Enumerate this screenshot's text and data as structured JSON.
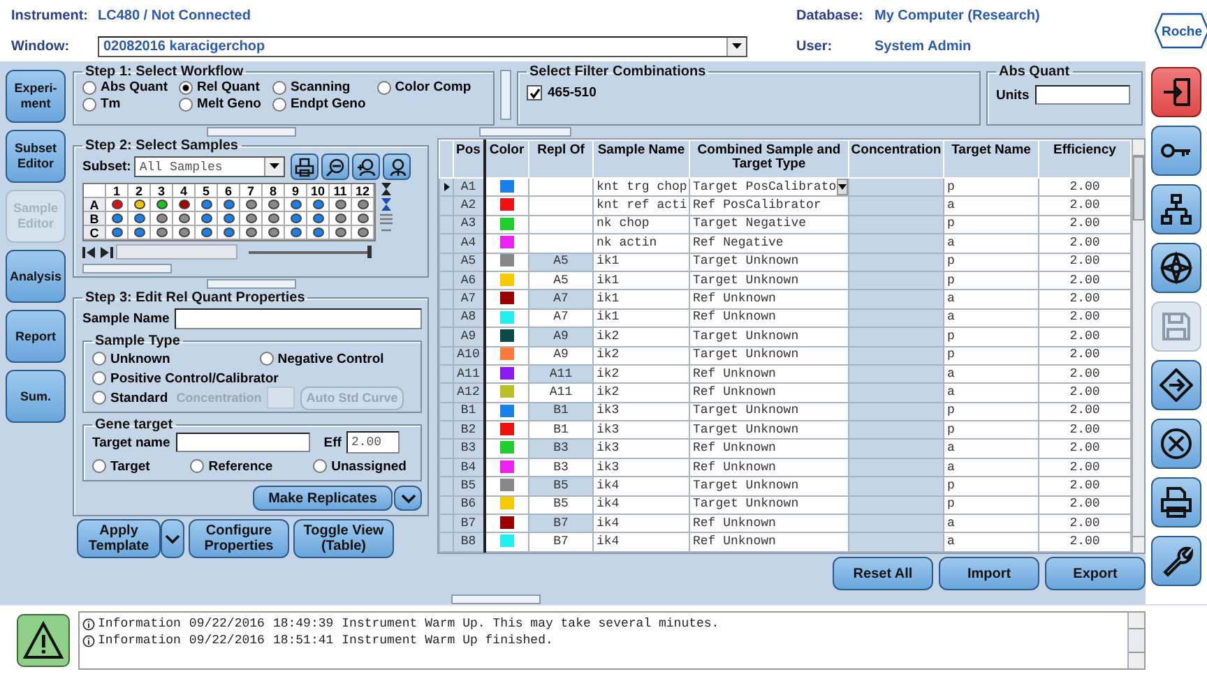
{
  "header": {
    "instrument_label": "Instrument:",
    "instrument": "LC480 / Not Connected",
    "window_label": "Window:",
    "window_value": "02082016 karacigerchop",
    "database_label": "Database:",
    "database": "My Computer (Research)",
    "user_label": "User:",
    "user": "System Admin",
    "logo": "Roche"
  },
  "nav": [
    {
      "label": "Experi-ment",
      "disabled": false
    },
    {
      "label": "Subset Editor",
      "disabled": false
    },
    {
      "label": "Sample Editor",
      "disabled": true
    },
    {
      "label": "Analysis",
      "disabled": false
    },
    {
      "label": "Report",
      "disabled": false
    },
    {
      "label": "Sum.",
      "disabled": false
    }
  ],
  "step1": {
    "title": "Step 1: Select Workflow",
    "options": [
      {
        "label": "Abs Quant",
        "selected": false
      },
      {
        "label": "Rel Quant",
        "selected": true
      },
      {
        "label": "Scanning",
        "selected": false
      },
      {
        "label": "Color Comp",
        "selected": false
      },
      {
        "label": "Tm",
        "selected": false
      },
      {
        "label": "Melt Geno",
        "selected": false
      },
      {
        "label": "Endpt Geno",
        "selected": false
      }
    ]
  },
  "filters": {
    "title": "Select Filter Combinations",
    "items": [
      {
        "label": "465-510",
        "checked": true
      }
    ]
  },
  "abs_quant": {
    "title": "Abs Quant",
    "units_label": "Units"
  },
  "step2": {
    "title": "Step 2: Select Samples",
    "subset_label": "Subset:",
    "subset_value": "All Samples",
    "zoom_slider": {
      "level": 1
    },
    "columns": [
      "1",
      "2",
      "3",
      "4",
      "5",
      "6",
      "7",
      "8",
      "9",
      "10",
      "11",
      "12"
    ],
    "rows": [
      {
        "label": "A",
        "wells": [
          {
            "color": "#e01010"
          },
          {
            "color": "#f0c800"
          },
          {
            "color": "#20c020"
          },
          {
            "color": "#a00000"
          },
          {
            "color": "#1a7fe8"
          },
          {
            "color": "#1a7fe8"
          },
          {
            "color": "#8a8a8a"
          },
          {
            "color": "#8a8a8a"
          },
          {
            "color": "#1a7fe8"
          },
          {
            "color": "#1a7fe8"
          },
          {
            "color": "#8a8a8a"
          },
          {
            "color": "#8a8a8a"
          }
        ]
      },
      {
        "label": "B",
        "wells": [
          {
            "color": "#1a7fe8"
          },
          {
            "color": "#1a7fe8"
          },
          {
            "color": "#8a8a8a"
          },
          {
            "color": "#8a8a8a"
          },
          {
            "color": "#1a7fe8"
          },
          {
            "color": "#1a7fe8"
          },
          {
            "color": "#8a8a8a"
          },
          {
            "color": "#8a8a8a"
          },
          {
            "color": "#1a7fe8"
          },
          {
            "color": "#1a7fe8"
          },
          {
            "color": "#8a8a8a"
          },
          {
            "color": "#8a8a8a"
          }
        ]
      },
      {
        "label": "C",
        "wells": [
          {
            "color": "#1a7fe8"
          },
          {
            "color": "#1a7fe8"
          },
          {
            "color": "#8a8a8a"
          },
          {
            "color": "#8a8a8a"
          },
          {
            "color": "#1a7fe8"
          },
          {
            "color": "#1a7fe8"
          },
          {
            "color": "#8a8a8a"
          },
          {
            "color": "#8a8a8a"
          },
          {
            "color": "#1a7fe8"
          },
          {
            "color": "#1a7fe8"
          },
          {
            "color": "#8a8a8a"
          },
          {
            "color": "#8a8a8a"
          }
        ]
      }
    ]
  },
  "step3": {
    "title": "Step 3: Edit Rel Quant Properties",
    "sample_name_label": "Sample Name",
    "sample_type": {
      "title": "Sample Type",
      "options": [
        {
          "label": "Unknown",
          "selected": false
        },
        {
          "label": "Negative Control",
          "selected": false
        },
        {
          "label": "Positive Control/Calibrator",
          "selected": false
        },
        {
          "label": "Standard",
          "selected": false
        }
      ],
      "concentration_label": "Concentration",
      "auto_button": "Auto Std Curve",
      "standard_disabled": true
    },
    "gene_target": {
      "title": "Gene target",
      "name_label": "Target name",
      "eff_label": "Eff",
      "eff_value": "2.00",
      "options": [
        {
          "label": "Target",
          "selected": false
        },
        {
          "label": "Reference",
          "selected": false
        },
        {
          "label": "Unassigned",
          "selected": false
        }
      ]
    },
    "make_replicates": "Make Replicates"
  },
  "bottom_buttons": [
    {
      "label": "Apply Template",
      "dropdown": true
    },
    {
      "label": "Configure Properties",
      "dropdown": false
    },
    {
      "label": "Toggle View (Table)",
      "dropdown": false
    }
  ],
  "table": {
    "columns": [
      "Pos",
      "Color",
      "Repl Of",
      "Sample Name",
      "Combined Sample and Target Type",
      "Concentration",
      "Target Name",
      "Efficiency"
    ],
    "rows": [
      {
        "pos": "A1",
        "color": "#1a7fe8",
        "sample_name": "knt trg chop",
        "type": "Target PosCalibrato",
        "target": "p",
        "efficiency": "2.00",
        "selected": true
      },
      {
        "pos": "A2",
        "color": "#ee1111",
        "sample_name": "knt ref acti",
        "type": "Ref PosCalibrator",
        "target": "a",
        "efficiency": "2.00",
        "selected": false
      },
      {
        "pos": "A3",
        "color": "#22cc33",
        "sample_name": "nk chop",
        "type": "Target Negative",
        "target": "p",
        "efficiency": "2.00",
        "selected": false
      },
      {
        "pos": "A4",
        "color": "#ee22ee",
        "sample_name": "nk actin",
        "type": "Ref Negative",
        "target": "a",
        "efficiency": "2.00",
        "selected": false
      },
      {
        "pos": "A5",
        "color": "#888888",
        "repl_of": "A5",
        "repl_shaded": true,
        "sample_name": "ik1",
        "type": "Target Unknown",
        "target": "p",
        "efficiency": "2.00",
        "selected": false
      },
      {
        "pos": "A6",
        "color": "#f5c800",
        "repl_of": "A5",
        "repl_shaded": false,
        "sample_name": "ik1",
        "type": "Target Unknown",
        "target": "p",
        "efficiency": "2.00",
        "selected": false
      },
      {
        "pos": "A7",
        "color": "#990000",
        "repl_of": "A7",
        "repl_shaded": true,
        "sample_name": "ik1",
        "type": "Ref Unknown",
        "target": "a",
        "efficiency": "2.00",
        "selected": false
      },
      {
        "pos": "A8",
        "color": "#22eeee",
        "repl_of": "A7",
        "repl_shaded": false,
        "sample_name": "ik1",
        "type": "Ref Unknown",
        "target": "a",
        "efficiency": "2.00",
        "selected": false
      },
      {
        "pos": "A9",
        "color": "#0b4a4a",
        "repl_of": "A9",
        "repl_shaded": true,
        "sample_name": "ik2",
        "type": "Target Unknown",
        "target": "p",
        "efficiency": "2.00",
        "selected": false
      },
      {
        "pos": "A10",
        "color": "#ff7a3a",
        "repl_of": "A9",
        "repl_shaded": false,
        "sample_name": "ik2",
        "type": "Target Unknown",
        "target": "p",
        "efficiency": "2.00",
        "selected": false
      },
      {
        "pos": "A11",
        "color": "#8a1aee",
        "repl_of": "A11",
        "repl_shaded": true,
        "sample_name": "ik2",
        "type": "Ref Unknown",
        "target": "a",
        "efficiency": "2.00",
        "selected": false
      },
      {
        "pos": "A12",
        "color": "#b8c02a",
        "repl_of": "A11",
        "repl_shaded": false,
        "sample_name": "ik2",
        "type": "Ref Unknown",
        "target": "a",
        "efficiency": "2.00",
        "selected": false
      },
      {
        "pos": "B1",
        "color": "#1a7fe8",
        "repl_of": "B1",
        "repl_shaded": true,
        "sample_name": "ik3",
        "type": "Target Unknown",
        "target": "p",
        "efficiency": "2.00",
        "selected": false
      },
      {
        "pos": "B2",
        "color": "#ee1111",
        "repl_of": "B1",
        "repl_shaded": false,
        "sample_name": "ik3",
        "type": "Target Unknown",
        "target": "p",
        "efficiency": "2.00",
        "selected": false
      },
      {
        "pos": "B3",
        "color": "#22cc33",
        "repl_of": "B3",
        "repl_shaded": true,
        "sample_name": "ik3",
        "type": "Ref Unknown",
        "target": "a",
        "efficiency": "2.00",
        "selected": false
      },
      {
        "pos": "B4",
        "color": "#ee22ee",
        "repl_of": "B3",
        "repl_shaded": false,
        "sample_name": "ik3",
        "type": "Ref Unknown",
        "target": "a",
        "efficiency": "2.00",
        "selected": false
      },
      {
        "pos": "B5",
        "color": "#888888",
        "repl_of": "B5",
        "repl_shaded": true,
        "sample_name": "ik4",
        "type": "Target Unknown",
        "target": "p",
        "efficiency": "2.00",
        "selected": false
      },
      {
        "pos": "B6",
        "color": "#f5c800",
        "repl_of": "B5",
        "repl_shaded": false,
        "sample_name": "ik4",
        "type": "Target Unknown",
        "target": "p",
        "efficiency": "2.00",
        "selected": false
      },
      {
        "pos": "B7",
        "color": "#990000",
        "repl_of": "B7",
        "repl_shaded": true,
        "sample_name": "ik4",
        "type": "Ref Unknown",
        "target": "a",
        "efficiency": "2.00",
        "selected": false
      },
      {
        "pos": "B8",
        "color": "#22eeee",
        "repl_of": "B7",
        "repl_shaded": false,
        "sample_name": "ik4",
        "type": "Ref Unknown",
        "target": "a",
        "efficiency": "2.00",
        "selected": false
      }
    ]
  },
  "table_buttons": [
    "Reset All",
    "Import",
    "Export"
  ],
  "log": [
    {
      "level": "Information",
      "date": "09/22/2016",
      "time": "18:49:39",
      "message": "Instrument Warm Up. This may take several minutes."
    },
    {
      "level": "Information",
      "date": "09/22/2016",
      "time": "18:51:41",
      "message": "Instrument Warm Up finished."
    }
  ],
  "tools": [
    {
      "kind": "exit",
      "disabled": false
    },
    {
      "kind": "key",
      "disabled": false
    },
    {
      "kind": "network",
      "disabled": false
    },
    {
      "kind": "compass",
      "disabled": false
    },
    {
      "kind": "save",
      "disabled": true
    },
    {
      "kind": "diamond",
      "disabled": false
    },
    {
      "kind": "cancel",
      "disabled": false
    },
    {
      "kind": "print",
      "disabled": false
    },
    {
      "kind": "wrench",
      "disabled": false
    }
  ]
}
